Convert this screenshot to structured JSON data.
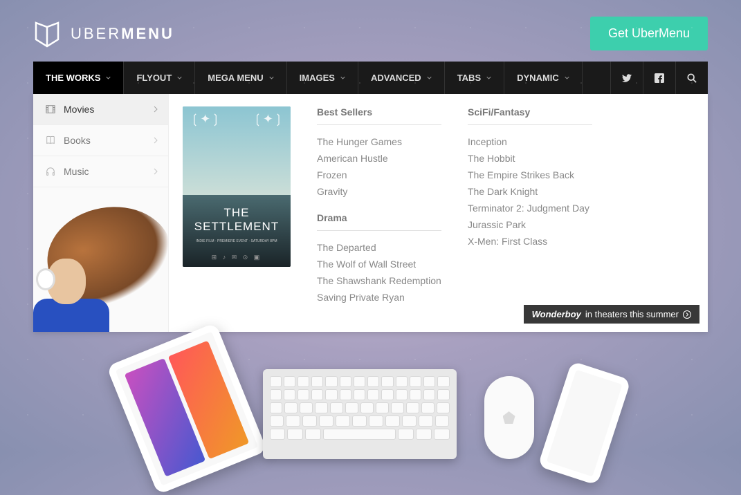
{
  "brand": {
    "name_light": "UBER",
    "name_bold": "MENU"
  },
  "cta": {
    "label": "Get UberMenu"
  },
  "nav": {
    "items": [
      {
        "label": "THE WORKS"
      },
      {
        "label": "FLYOUT"
      },
      {
        "label": "MEGA MENU"
      },
      {
        "label": "IMAGES"
      },
      {
        "label": "ADVANCED"
      },
      {
        "label": "TABS"
      },
      {
        "label": "DYNAMIC"
      }
    ]
  },
  "sidebar": {
    "items": [
      {
        "label": "Movies"
      },
      {
        "label": "Books"
      },
      {
        "label": "Music"
      }
    ]
  },
  "poster": {
    "title": "THE SETTLEMENT",
    "subtitle": "INDIE FILM · PREMIERE EVENT · SATURDAY 8PM"
  },
  "columns": [
    {
      "heading": "Best Sellers",
      "links": [
        "The Hunger Games",
        "American Hustle",
        "Frozen",
        "Gravity"
      ]
    },
    {
      "heading": "Drama",
      "links": [
        "The Departed",
        "The Wolf of Wall Street",
        "The Shawshank Redemption",
        "Saving Private Ryan"
      ]
    },
    {
      "heading": "SciFi/Fantasy",
      "links": [
        "Inception",
        "The Hobbit",
        "The Empire Strikes Back",
        "The Dark Knight",
        "Terminator 2: Judgment Day",
        "Jurassic Park",
        "X-Men: First Class"
      ]
    }
  ],
  "caption": {
    "title": "Wonderboy",
    "rest": " in theaters this summer"
  }
}
